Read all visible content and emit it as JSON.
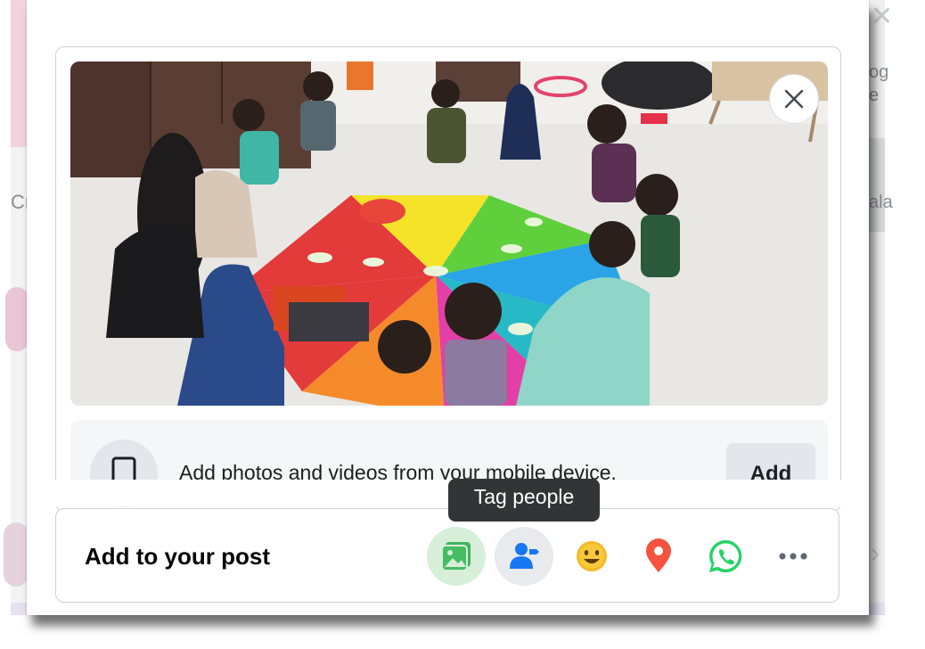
{
  "background": {
    "left_text": "Cr",
    "right_text_top": "og\ne",
    "right_text_mid": "ala"
  },
  "composer": {
    "photo_close_icon": "close-icon",
    "mobile_upload": {
      "text": "Add photos and videos from your mobile device.",
      "button_label": "Add",
      "icon": "mobile-phone-icon"
    },
    "add_to_post": {
      "label": "Add to your post",
      "tooltip": "Tag people",
      "actions": [
        {
          "name": "photo-video",
          "icon": "photo-icon",
          "color": "#45bd62"
        },
        {
          "name": "tag-people",
          "icon": "tag-people-icon",
          "color": "#1877f2"
        },
        {
          "name": "feeling",
          "icon": "smiley-icon",
          "color": "#f7b928"
        },
        {
          "name": "check-in",
          "icon": "location-pin-icon",
          "color": "#f5533d"
        },
        {
          "name": "whatsapp",
          "icon": "whatsapp-icon",
          "color": "#25d366"
        },
        {
          "name": "more",
          "icon": "more-icon",
          "color": "#606770"
        }
      ]
    }
  }
}
